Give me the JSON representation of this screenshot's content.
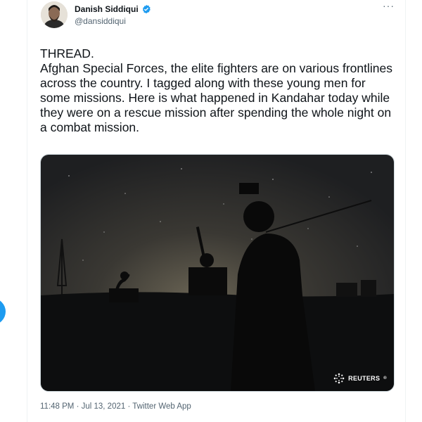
{
  "tweet": {
    "author_name": "Danish Siddiqui",
    "author_handle": "@dansiddiqui",
    "verified": true,
    "more_label": "···",
    "text": "THREAD.\nAfghan Special Forces, the elite fighters are on various frontlines across the country. I tagged along with these young men for some missions. Here is what happened in Kandahar today while they were on a rescue mission after spending the whole night on a combat mission.",
    "media": {
      "watermark": "REUTERS",
      "watermark_sup": "®"
    },
    "time": "11:48 PM",
    "date": "Jul 13, 2021",
    "source": "Twitter Web App",
    "separator": " · "
  },
  "colors": {
    "accent": "#1d9bf0",
    "text": "#0f1419",
    "secondary": "#536471"
  }
}
